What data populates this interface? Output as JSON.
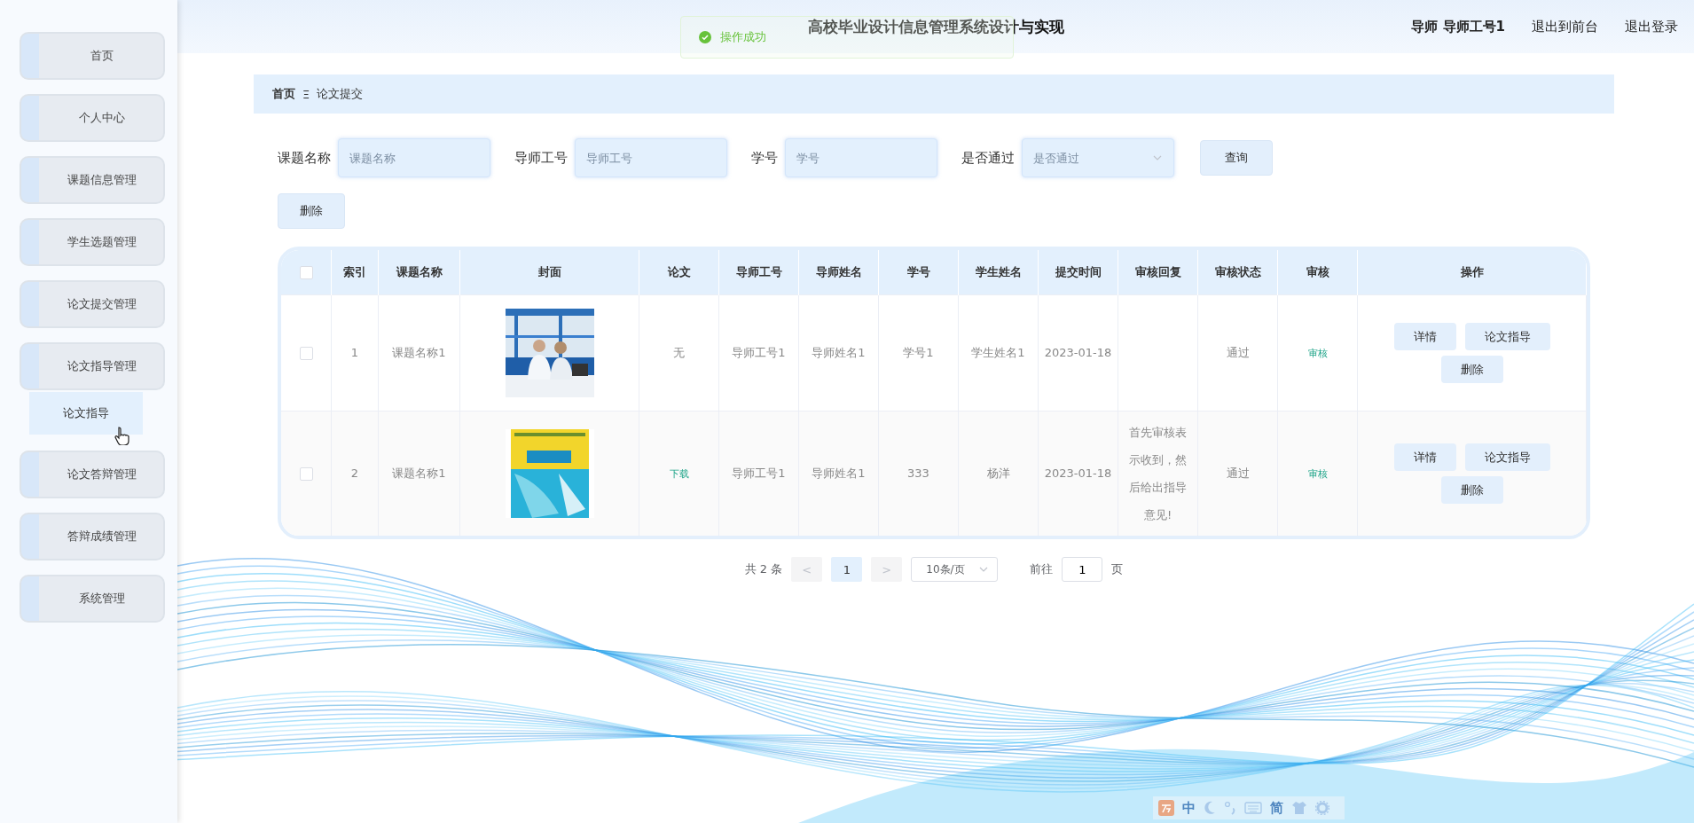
{
  "header": {
    "title": "高校毕业设计信息管理系统设计与实现",
    "user": "导师 导师工号1",
    "links": [
      "退出到前台",
      "退出登录"
    ]
  },
  "toast": {
    "message": "操作成功"
  },
  "sidebar": {
    "items": [
      {
        "label": "首页",
        "selected": false
      },
      {
        "label": "个人中心",
        "selected": false
      },
      {
        "label": "课题信息管理",
        "selected": false
      },
      {
        "label": "学生选题管理",
        "selected": false
      },
      {
        "label": "论文提交管理",
        "selected": false
      },
      {
        "label": "论文指导管理",
        "selected": false,
        "expanded": true,
        "children": [
          {
            "label": "论文指导",
            "selected": true
          }
        ]
      },
      {
        "label": "论文答辩管理",
        "selected": false
      },
      {
        "label": "答辩成绩管理",
        "selected": false
      },
      {
        "label": "系统管理",
        "selected": false
      }
    ]
  },
  "breadcrumb": {
    "items": [
      "首页",
      "论文提交"
    ],
    "separator": "Ξ"
  },
  "filters": [
    {
      "kind": "text",
      "label": "课题名称",
      "placeholder": "课题名称"
    },
    {
      "kind": "text",
      "label": "导师工号",
      "placeholder": "导师工号"
    },
    {
      "kind": "text",
      "label": "学号",
      "placeholder": "学号"
    },
    {
      "kind": "select",
      "label": "是否通过",
      "placeholder": "是否通过"
    }
  ],
  "search_button": "查询",
  "delete_button": "删除",
  "table": {
    "select_all": {
      "checked": false
    },
    "columns": [
      "索引",
      "课题名称",
      "封面",
      "论文",
      "导师工号",
      "导师姓名",
      "学号",
      "学生姓名",
      "提交时间",
      "审核回复",
      "审核状态",
      "审核",
      "操作"
    ],
    "rows": [
      {
        "checked": false,
        "index": "1",
        "topic": "课题名称1",
        "cover": {
          "kind": "picture"
        },
        "thesis": {
          "kind": "text",
          "text": "无"
        },
        "tutor_id": "导师工号1",
        "tutor_name": "导师姓名1",
        "student_id": "学号1",
        "student_name": "学生姓名1",
        "submit_time": "2023-01-18",
        "review_status": "通过",
        "review_action": "审核",
        "actions": [
          "详情",
          "论文指导",
          "删除"
        ]
      },
      {
        "checked": false,
        "index": "2",
        "topic": "课题名称1",
        "cover": {
          "kind": "picture"
        },
        "thesis": {
          "kind": "link",
          "text": "下载"
        },
        "tutor_id": "导师工号1",
        "tutor_name": "导师姓名1",
        "student_id": "333",
        "student_name": "杨洋",
        "submit_time": "2023-01-18",
        "review_reply": "首先审核表示收到，然后给出指导意见!",
        "review_status": "通过",
        "review_action": "审核",
        "actions": [
          "详情",
          "论文指导",
          "删除"
        ]
      }
    ]
  },
  "pagination": {
    "total": "共 2 条",
    "prev": "<",
    "pages": [
      {
        "label": "1",
        "selected": true
      }
    ],
    "next": ">",
    "page_size": "10条/页",
    "goto_label": "前往",
    "goto_value": "1",
    "goto_suffix": "页"
  },
  "ime_bar": {
    "language": "中",
    "charset": "简"
  }
}
